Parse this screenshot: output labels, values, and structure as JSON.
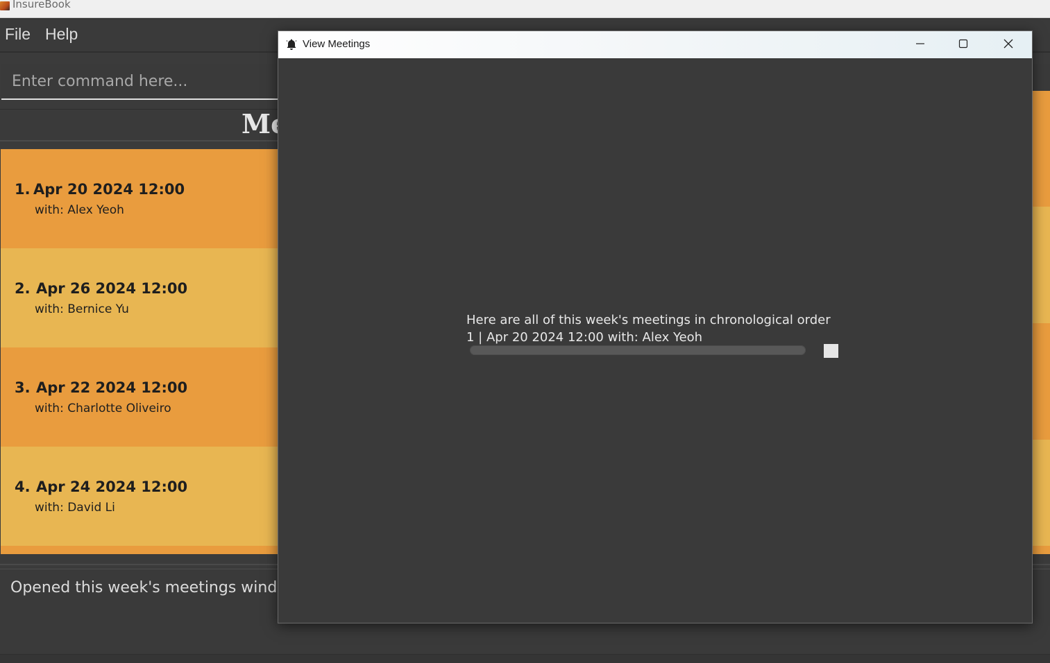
{
  "app": {
    "title": "InsureBook"
  },
  "menu": {
    "file": "File",
    "help": "Help"
  },
  "command": {
    "placeholder": "Enter command here..."
  },
  "panel": {
    "title": "Me"
  },
  "meetings": [
    {
      "index": "1.",
      "datetime": "Apr 20 2024 12:00",
      "with": "with: Alex Yeoh"
    },
    {
      "index": "2.",
      "datetime": "Apr 26 2024 12:00",
      "with": "with: Bernice Yu"
    },
    {
      "index": "3.",
      "datetime": "Apr 22 2024 12:00",
      "with": "with: Charlotte Oliveiro"
    },
    {
      "index": "4.",
      "datetime": "Apr 24 2024 12:00",
      "with": "with: David Li"
    }
  ],
  "result": {
    "message": "Opened this week's meetings window."
  },
  "dialog": {
    "title": "View Meetings",
    "line1": "Here are all of this week's meetings in chronological order",
    "line2": "1 | Apr 20 2024 12:00 with: Alex Yeoh",
    "icons": {
      "app": "bell-icon",
      "minimize": "minimize-icon",
      "maximize": "maximize-icon",
      "close": "close-icon"
    }
  },
  "colors": {
    "card_odd": "#e99c3e",
    "card_even": "#e8b652",
    "background": "#3a3a3a"
  }
}
